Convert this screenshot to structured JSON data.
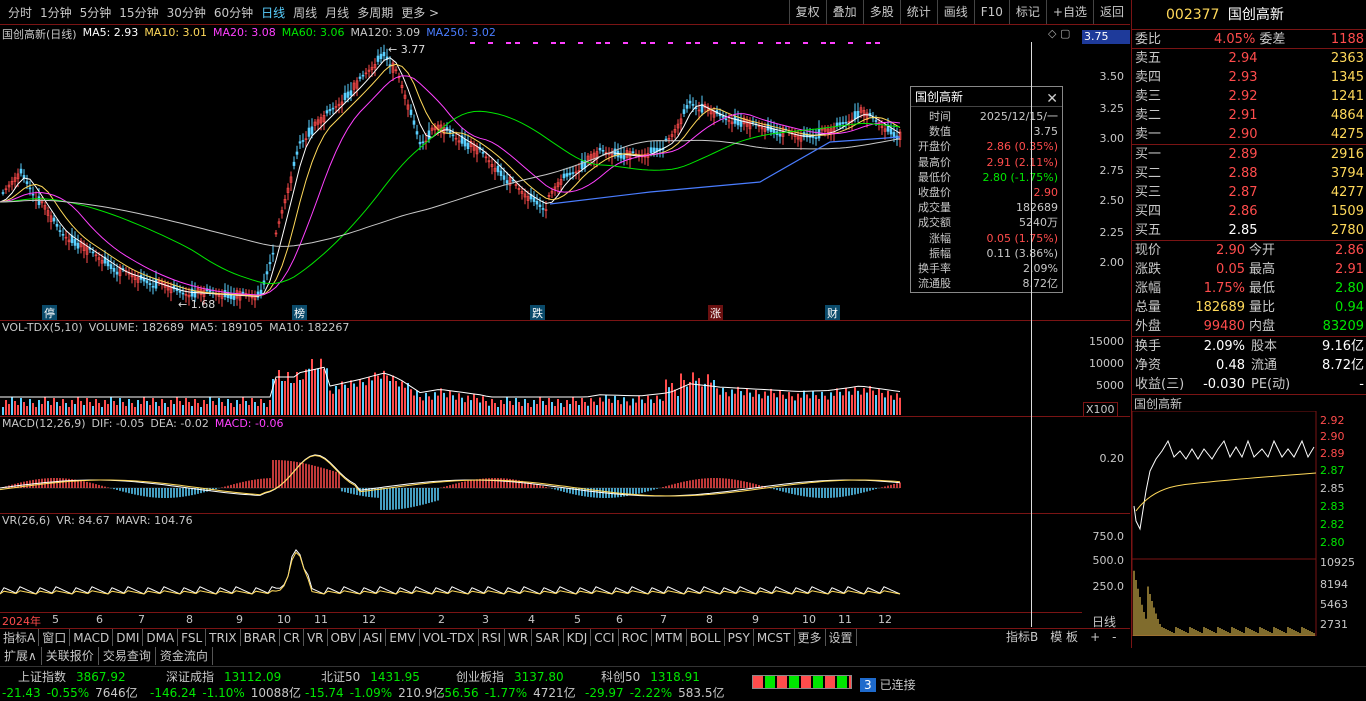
{
  "toolbar": {
    "periods": [
      "分时",
      "1分钟",
      "5分钟",
      "15分钟",
      "30分钟",
      "60分钟",
      "日线",
      "周线",
      "月线",
      "多周期",
      "更多 >"
    ],
    "active_period": "日线",
    "tools": [
      "复权",
      "叠加",
      "多股",
      "统计",
      "画线",
      "F10",
      "标记",
      "+自选",
      "返回"
    ]
  },
  "main_chart": {
    "title": "国创高新(日线)",
    "ma": [
      {
        "label": "MA5: 2.93",
        "color": "#ffffff"
      },
      {
        "label": "MA10: 3.01",
        "color": "#ffd95a"
      },
      {
        "label": "MA20: 3.08",
        "color": "#ff40ff"
      },
      {
        "label": "MA60: 3.06",
        "color": "#00e600"
      },
      {
        "label": "MA120: 3.09",
        "color": "#c8c8c8"
      },
      {
        "label": "MA250: 3.02",
        "color": "#4a7dff"
      }
    ],
    "y_ticks": [
      "3.50",
      "3.25",
      "3.00",
      "2.75",
      "2.50",
      "2.25",
      "2.00"
    ],
    "current_price_label": "3.75",
    "high_label": "3.77",
    "low_label": "1.68",
    "events": [
      "停",
      "榜",
      "跌",
      "涨",
      "财"
    ]
  },
  "volume_panel": {
    "header": [
      "VOL-TDX(5,10)",
      "VOLUME: 182689",
      "MA5: 189105",
      "MA10: 182267"
    ],
    "y_ticks": [
      "15000",
      "10000",
      "5000"
    ],
    "unit": "X100"
  },
  "macd_panel": {
    "header": [
      "MACD(12,26,9)",
      "DIF: -0.05",
      "DEA: -0.02",
      "MACD: -0.06"
    ],
    "y_ticks": [
      "0.20"
    ]
  },
  "vr_panel": {
    "header": [
      "VR(26,6)",
      "VR: 84.67",
      "MAVR: 104.76"
    ],
    "y_ticks": [
      "750.0",
      "500.0",
      "250.0"
    ]
  },
  "x_axis": {
    "labels": [
      "2024年",
      "5",
      "6",
      "7",
      "8",
      "9",
      "10",
      "11",
      "12",
      "2",
      "3",
      "4",
      "5",
      "6",
      "7",
      "8",
      "9",
      "10",
      "11",
      "12"
    ],
    "period_label": "日线"
  },
  "bottom_tabs": [
    "指标A",
    "窗口",
    "MACD",
    "DMI",
    "DMA",
    "FSL",
    "TRIX",
    "BRAR",
    "CR",
    "VR",
    "OBV",
    "ASI",
    "EMV",
    "VOL-TDX",
    "RSI",
    "WR",
    "SAR",
    "KDJ",
    "CCI",
    "ROC",
    "MTM",
    "BOLL",
    "PSY",
    "MCST",
    "更多",
    "设置"
  ],
  "bottom_tabs_right": [
    "指标B",
    "模 板",
    "+",
    "-"
  ],
  "bottom_bar2": [
    "扩展∧",
    "关联报价",
    "交易查询",
    "资金流向"
  ],
  "tooltip": {
    "title": "国创高新",
    "rows": [
      {
        "k": "时间",
        "v": "2025/12/15/一",
        "c": "#c8c8c8"
      },
      {
        "k": "数值",
        "v": "3.75",
        "c": "#c8c8c8"
      },
      {
        "k": "开盘价",
        "v": "2.86 (0.35%)",
        "c": "#ff4c4c"
      },
      {
        "k": "最高价",
        "v": "2.91 (2.11%)",
        "c": "#ff4c4c"
      },
      {
        "k": "最低价",
        "v": "2.80 (-1.75%)",
        "c": "#00e600"
      },
      {
        "k": "收盘价",
        "v": "2.90",
        "c": "#ff4c4c"
      },
      {
        "k": "成交量",
        "v": "182689",
        "c": "#c8c8c8"
      },
      {
        "k": "成交额",
        "v": "5240万",
        "c": "#c8c8c8"
      },
      {
        "k": "涨幅",
        "v": "0.05 (1.75%)",
        "c": "#ff4c4c"
      },
      {
        "k": "振幅",
        "v": "0.11 (3.86%)",
        "c": "#c8c8c8"
      },
      {
        "k": "换手率",
        "v": "2.09%",
        "c": "#c8c8c8"
      },
      {
        "k": "流通股",
        "v": "8.72亿",
        "c": "#c8c8c8"
      }
    ]
  },
  "quote": {
    "code": "002377",
    "name": "国创高新",
    "weibi_label": "委比",
    "weibi": "4.05%",
    "weicha_label": "委差",
    "weicha": "1188",
    "sells": [
      {
        "label": "卖五",
        "price": "2.94",
        "vol": "2363"
      },
      {
        "label": "卖四",
        "price": "2.93",
        "vol": "1345"
      },
      {
        "label": "卖三",
        "price": "2.92",
        "vol": "1241"
      },
      {
        "label": "卖二",
        "price": "2.91",
        "vol": "4864"
      },
      {
        "label": "卖一",
        "price": "2.90",
        "vol": "4275"
      }
    ],
    "buys": [
      {
        "label": "买一",
        "price": "2.89",
        "vol": "2916"
      },
      {
        "label": "买二",
        "price": "2.88",
        "vol": "3794"
      },
      {
        "label": "买三",
        "price": "2.87",
        "vol": "4277"
      },
      {
        "label": "买四",
        "price": "2.86",
        "vol": "1509"
      },
      {
        "label": "买五",
        "price": "2.85",
        "vol": "2780"
      }
    ],
    "stats": [
      {
        "l1": "现价",
        "v1": "2.90",
        "c1": "#ff4c4c",
        "l2": "今开",
        "v2": "2.86",
        "c2": "#ff4c4c"
      },
      {
        "l1": "涨跌",
        "v1": "0.05",
        "c1": "#ff4c4c",
        "l2": "最高",
        "v2": "2.91",
        "c2": "#ff4c4c"
      },
      {
        "l1": "涨幅",
        "v1": "1.75%",
        "c1": "#ff4c4c",
        "l2": "最低",
        "v2": "2.80",
        "c2": "#00e600"
      },
      {
        "l1": "总量",
        "v1": "182689",
        "c1": "#ffd95a",
        "l2": "量比",
        "v2": "0.94",
        "c2": "#00e600"
      },
      {
        "l1": "外盘",
        "v1": "99480",
        "c1": "#ff4c4c",
        "l2": "内盘",
        "v2": "83209",
        "c2": "#00e600"
      }
    ],
    "stats2": [
      {
        "l1": "换手",
        "v1": "2.09%",
        "l2": "股本",
        "v2": "9.16亿"
      },
      {
        "l1": "净资",
        "v1": "0.48",
        "l2": "流通",
        "v2": "8.72亿"
      },
      {
        "l1": "收益(三)",
        "v1": "-0.030",
        "l2": "PE(动)",
        "v2": "-"
      }
    ],
    "mini_title": "国创高新",
    "mini_ticks": [
      "2.92",
      "2.90",
      "2.89",
      "2.87",
      "2.85",
      "2.83",
      "2.82",
      "2.80",
      "10925",
      "8194",
      "5463",
      "2731"
    ]
  },
  "status_bar": {
    "indices": [
      {
        "name": "上证指数",
        "value": "3867.92",
        "chg": "-21.43",
        "pct": "-0.55%",
        "amt": "7646亿"
      },
      {
        "name": "深证成指",
        "value": "13112.09",
        "chg": "-146.24",
        "pct": "-1.10%",
        "amt": "10088亿"
      },
      {
        "name": "北证50",
        "value": "1431.95",
        "chg": "-15.74",
        "pct": "-1.09%",
        "amt": "210.9亿"
      },
      {
        "name": "创业板指",
        "value": "3137.80",
        "chg": "-56.56",
        "pct": "-1.77%",
        "amt": "4721亿"
      },
      {
        "name": "科创50",
        "value": "1318.91",
        "chg": "-29.97",
        "pct": "-2.22%",
        "amt": "583.5亿"
      }
    ],
    "conn_badge": "3",
    "conn_text": "已连接"
  }
}
